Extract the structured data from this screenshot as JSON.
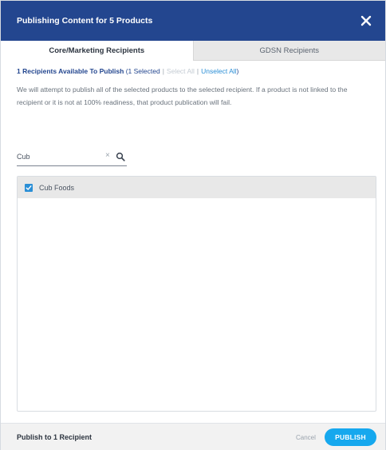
{
  "modal": {
    "title": "Publishing Content for 5 Products",
    "close_icon": "close-icon"
  },
  "tabs": [
    {
      "label": "Core/Marketing Recipients",
      "active": true
    },
    {
      "label": "GDSN Recipients",
      "active": false
    }
  ],
  "summary": {
    "available": "1 Recipients Available To Publish",
    "open_paren": "(",
    "selected": "1 Selected",
    "separator": "|",
    "select_all": "Select All",
    "unselect_all": "Unselect All",
    "close_paren": ")"
  },
  "description": "We will attempt to publish all of the selected products to the selected recipient. If a product is not linked to the recipient or it is not at 100% readiness, that product publication will fail.",
  "search": {
    "value": "Cub",
    "clear_icon": "×",
    "search_icon": "search-icon"
  },
  "recipients": [
    {
      "label": "Cub Foods",
      "checked": true
    }
  ],
  "footer": {
    "label": "Publish to 1 Recipient",
    "cancel": "Cancel",
    "publish": "PUBLISH"
  },
  "colors": {
    "header": "#23468f",
    "accent": "#16a8ee",
    "link": "#2b8fd6",
    "checkbox": "#2b8fd6"
  }
}
